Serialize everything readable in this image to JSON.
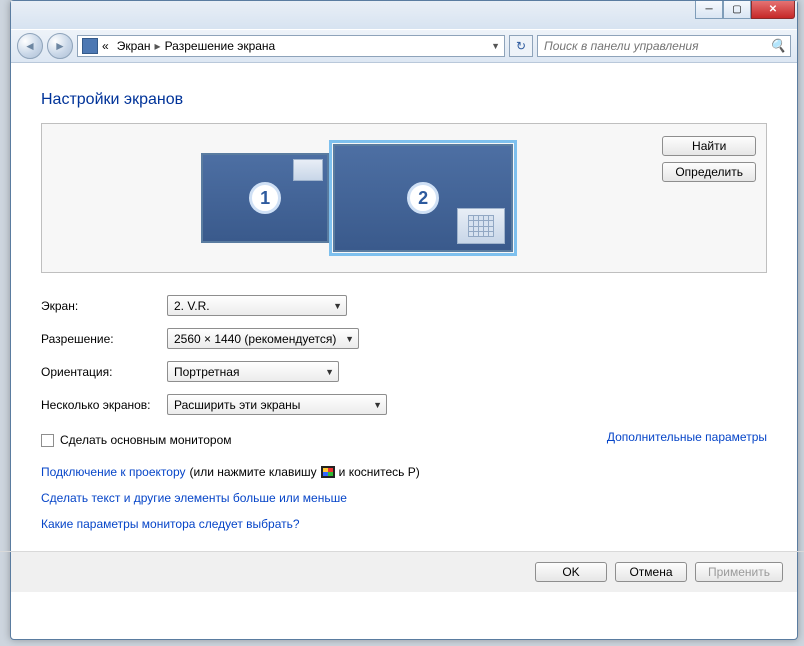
{
  "breadcrumb": {
    "item1": "Экран",
    "item2": "Разрешение экрана",
    "chevrons": "«"
  },
  "search": {
    "placeholder": "Поиск в панели управления"
  },
  "page_title": "Настройки экранов",
  "monitors": {
    "m1_num": "1",
    "m2_num": "2"
  },
  "preview_buttons": {
    "find": "Найти",
    "identify": "Определить"
  },
  "labels": {
    "display": "Экран:",
    "resolution": "Разрешение:",
    "orientation": "Ориентация:",
    "multiple": "Несколько экранов:"
  },
  "values": {
    "display": "2. V.R.",
    "resolution": "2560 × 1440 (рекомендуется)",
    "orientation": "Портретная",
    "multiple": "Расширить эти экраны"
  },
  "checkbox_label": "Сделать основным монитором",
  "advanced_link": "Дополнительные параметры",
  "projector": {
    "link": "Подключение к проектору",
    "rest1": " (или нажмите клавишу ",
    "rest2": " и коснитесь P)"
  },
  "text_size_link": "Сделать текст и другие элементы больше или меньше",
  "which_settings_link": "Какие параметры монитора следует выбрать?",
  "buttons": {
    "ok": "OK",
    "cancel": "Отмена",
    "apply": "Применить"
  }
}
